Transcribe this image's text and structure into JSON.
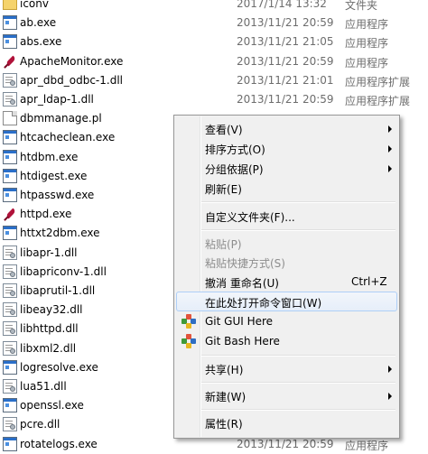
{
  "files": [
    {
      "name": "iconv",
      "date": "2017/1/14 13:32",
      "type": "文件夹",
      "icon": "folder-icon"
    },
    {
      "name": "ab.exe",
      "date": "2013/11/21 20:59",
      "type": "应用程序",
      "icon": "exe-icon"
    },
    {
      "name": "abs.exe",
      "date": "2013/11/21 21:05",
      "type": "应用程序",
      "icon": "exe-icon"
    },
    {
      "name": "ApacheMonitor.exe",
      "date": "2013/11/21 20:59",
      "type": "应用程序",
      "icon": "apache-feather-icon"
    },
    {
      "name": "apr_dbd_odbc-1.dll",
      "date": "2013/11/21 21:01",
      "type": "应用程序扩展",
      "icon": "dll-icon"
    },
    {
      "name": "apr_ldap-1.dll",
      "date": "2013/11/21 20:59",
      "type": "应用程序扩展",
      "icon": "dll-icon"
    },
    {
      "name": "dbmmanage.pl",
      "date": "",
      "type": "",
      "icon": "pl-file-icon"
    },
    {
      "name": "htcacheclean.exe",
      "date": "",
      "type": "",
      "icon": "exe-icon"
    },
    {
      "name": "htdbm.exe",
      "date": "",
      "type": "",
      "icon": "exe-icon"
    },
    {
      "name": "htdigest.exe",
      "date": "",
      "type": "",
      "icon": "exe-icon"
    },
    {
      "name": "htpasswd.exe",
      "date": "",
      "type": "",
      "icon": "exe-icon"
    },
    {
      "name": "httpd.exe",
      "date": "",
      "type": "",
      "icon": "apache-feather-icon"
    },
    {
      "name": "httxt2dbm.exe",
      "date": "",
      "type": "",
      "icon": "exe-icon"
    },
    {
      "name": "libapr-1.dll",
      "date": "",
      "type": "",
      "icon": "dll-icon"
    },
    {
      "name": "libapriconv-1.dll",
      "date": "",
      "type": "",
      "icon": "dll-icon"
    },
    {
      "name": "libaprutil-1.dll",
      "date": "",
      "type": "",
      "icon": "dll-icon"
    },
    {
      "name": "libeay32.dll",
      "date": "",
      "type": "",
      "icon": "dll-icon"
    },
    {
      "name": "libhttpd.dll",
      "date": "",
      "type": "",
      "icon": "dll-icon"
    },
    {
      "name": "libxml2.dll",
      "date": "",
      "type": "",
      "icon": "dll-icon"
    },
    {
      "name": "logresolve.exe",
      "date": "",
      "type": "",
      "icon": "exe-icon"
    },
    {
      "name": "lua51.dll",
      "date": "",
      "type": "",
      "icon": "dll-icon"
    },
    {
      "name": "openssl.exe",
      "date": "",
      "type": "",
      "icon": "exe-icon"
    },
    {
      "name": "pcre.dll",
      "date": "",
      "type": "",
      "icon": "dll-icon"
    },
    {
      "name": "rotatelogs.exe",
      "date": "2013/11/21 20:59",
      "type": "应用程序",
      "icon": "exe-icon"
    }
  ],
  "menu": {
    "view": "查看(V)",
    "sort_by": "排序方式(O)",
    "group_by": "分组依据(P)",
    "refresh": "刷新(E)",
    "customize_folder": "自定义文件夹(F)...",
    "paste": "粘贴(P)",
    "paste_shortcut": "粘贴快捷方式(S)",
    "undo_rename": "撤消 重命名(U)",
    "undo_shortcut": "Ctrl+Z",
    "open_cmd_here": "在此处打开命令窗口(W)",
    "git_gui_here": "Git GUI Here",
    "git_bash_here": "Git Bash Here",
    "share": "共享(H)",
    "new": "新建(W)",
    "properties": "属性(R)"
  },
  "colors": {
    "menu_bg": "#f0f0f0",
    "hover_border": "#aecff7",
    "disabled_text": "#8d8d8d"
  }
}
